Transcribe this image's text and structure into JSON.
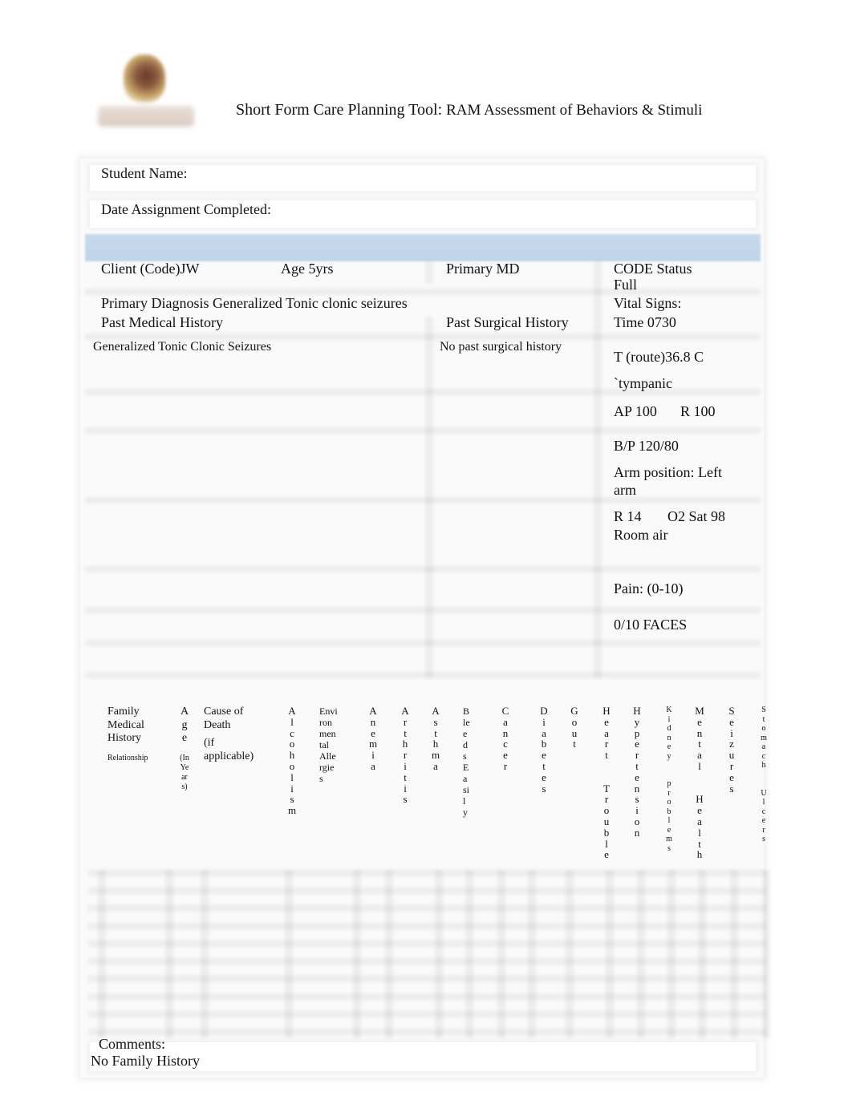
{
  "header": {
    "title_main": "Short Form Care Planning Tool: ",
    "title_sub": "RAM Assessment of Behaviors & Stimuli",
    "logo": "institution-crest-logo"
  },
  "student": {
    "name_label": "Student Name:",
    "name_value": "",
    "date_label": "Date Assignment Completed:",
    "date_value": ""
  },
  "client": {
    "code_label": "Client (Code)JW",
    "age_label": "Age 5yrs",
    "primary_md_label": "Primary MD",
    "code_status_label": "CODE Status",
    "code_status_value": "Full",
    "primary_diagnosis": "Primary Diagnosis Generalized Tonic clonic seizures",
    "past_medical_history_label": "Past Medical History",
    "past_medical_history_value": "Generalized Tonic Clonic Seizures",
    "past_surgical_history_label": "Past Surgical History",
    "past_surgical_history_value": "No past surgical history"
  },
  "vitals": {
    "label": "Vital Signs:",
    "time": "Time 0730",
    "temp": "T (route)36.8 C",
    "temp_route": "`tympanic",
    "ap": "AP 100",
    "r_pulse": "R 100",
    "bp": "B/P 120/80",
    "arm_position_line1": "Arm position: Left",
    "arm_position_line2": "arm",
    "resp": "R 14",
    "o2_sat": "O2 Sat  98",
    "o2_source": "Room air",
    "pain_label": "Pain: (0-10)",
    "pain_value": "0/10 FACES"
  },
  "family_history": {
    "title_lines": [
      "Family",
      "Medical",
      "History"
    ],
    "relationship_label": "Relationship",
    "age_label": "Age",
    "age_sub": "(In Years)",
    "cause_label_lines": [
      "Cause of",
      "Death"
    ],
    "cause_sub_lines": [
      "(if",
      "applicable)"
    ],
    "conditions": [
      {
        "label": "Alcoholism",
        "display": "Alcoholism"
      },
      {
        "label": "Environmental Allergies",
        "display": [
          "Envi",
          "ron",
          "men",
          "tal",
          "Alle",
          "rgie",
          "s"
        ]
      },
      {
        "label": "Anemia",
        "display": "Anemia"
      },
      {
        "label": "Arthritis",
        "display": "Arthritis"
      },
      {
        "label": "Asthma",
        "display": "Asthma"
      },
      {
        "label": "Bleeds Easily",
        "display": [
          "B",
          "le",
          "e",
          "d",
          "s",
          "E",
          "a",
          "si",
          "l",
          "y"
        ]
      },
      {
        "label": "Cancer",
        "display": "Cancer"
      },
      {
        "label": "Diabetes",
        "display": "Diabetes"
      },
      {
        "label": "Gout",
        "display": "Gout"
      },
      {
        "label": "Heart Trouble",
        "display": "Heart  Trouble"
      },
      {
        "label": "Hypertension",
        "display": "Hypertension"
      },
      {
        "label": "Kidney problems",
        "display": "Kidney  problems"
      },
      {
        "label": "Mental Health",
        "display": "Mental  Health"
      },
      {
        "label": "Seizures",
        "display": "Seizures"
      },
      {
        "label": "Stomach Ulcers",
        "display": "Stomach  Ulcers"
      }
    ],
    "rows": 9
  },
  "comments": {
    "label": "Comments:",
    "value": "No Family History"
  }
}
